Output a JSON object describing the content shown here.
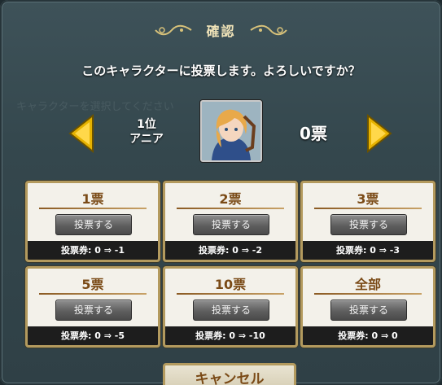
{
  "dialog": {
    "title": "確認",
    "question": "このキャラクターに投票します。よろしいですか？"
  },
  "character": {
    "rank": "1位",
    "name": "アニア",
    "current_votes": "0票"
  },
  "vote_options": [
    {
      "amount": "1票",
      "button_label": "投票する",
      "ticket_info": "投票券: 0 ⇒ -1"
    },
    {
      "amount": "2票",
      "button_label": "投票する",
      "ticket_info": "投票券: 0 ⇒ -2"
    },
    {
      "amount": "3票",
      "button_label": "投票する",
      "ticket_info": "投票券: 0 ⇒ -3"
    },
    {
      "amount": "5票",
      "button_label": "投票する",
      "ticket_info": "投票券: 0 ⇒ -5"
    },
    {
      "amount": "10票",
      "button_label": "投票する",
      "ticket_info": "投票券: 0 ⇒ -10"
    },
    {
      "amount": "全部",
      "button_label": "投票する",
      "ticket_info": "投票券: 0 ⇒ 0"
    }
  ],
  "cancel_label": "キャンセル",
  "background": {
    "watermark_subtitle": "キャラクターを選択してください"
  },
  "colors": {
    "panel_bg": "#3e5259",
    "card_border": "#b39a5e",
    "amount_text": "#7a4a16",
    "arrow_fill": "#e6b200"
  },
  "icons": {
    "left_arrow": "arrow-left-icon",
    "right_arrow": "arrow-right-icon",
    "ornament": "ornament-icon"
  }
}
